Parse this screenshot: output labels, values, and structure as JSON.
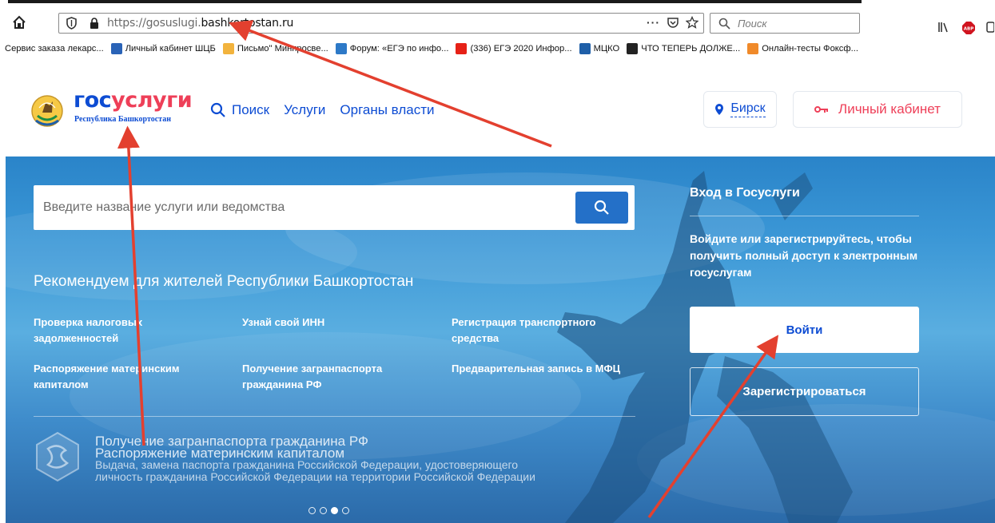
{
  "browser": {
    "url_prefix": "https://gosuslugi.",
    "url_domain": "bashkortostan.ru",
    "url_more": "···",
    "search_placeholder": "Поиск",
    "bookmarks": [
      {
        "label": "Сервис заказа лекарс...",
        "color": "transparent"
      },
      {
        "label": "Личный кабинет ШЦБ",
        "color": "#2a63b7"
      },
      {
        "label": "Письмо\" Минпросве...",
        "color": "#f2b33d"
      },
      {
        "label": "Форум: «ЕГЭ по инфо...",
        "color": "#2d79c7"
      },
      {
        "label": "(336) ЕГЭ 2020 Инфор...",
        "color": "#e62117"
      },
      {
        "label": "МЦКО",
        "color": "#1f5fa8"
      },
      {
        "label": "ЧТО ТЕПЕРЬ ДОЛЖЕ...",
        "color": "#222222"
      },
      {
        "label": "Онлайн-тесты Фоксф...",
        "color": "#f08a2a"
      }
    ]
  },
  "header": {
    "logo_part1": "гос",
    "logo_part2": "услуги",
    "logo_sub": "Республика Башкортостан",
    "nav": {
      "search": "Поиск",
      "services": "Услуги",
      "authorities": "Органы власти"
    },
    "city": "Бирск",
    "cabinet": "Личный кабинет"
  },
  "hero": {
    "search_placeholder": "Введите название услуги или ведомства",
    "rec_title": "Рекомендуем для жителей Республики Башкортостан",
    "rec_items": [
      "Проверка налоговых задолженностей",
      "Узнай свой ИНН",
      "Регистрация транспортного средства",
      "Распоряжение материнским капиталом",
      "Получение загранпаспорта гражданина РФ",
      "Предварительная запись в МФЦ"
    ],
    "slide_lines": [
      "Получение загранпаспорта гражданина РФ",
      "Распоряжение материнским капиталом",
      "Выдача, замена паспорта гражданина Российской Федерации, удостоверяющего",
      "личность гражданина Российской Федерации на территории Российской Федерации"
    ],
    "slides_total": 4,
    "slide_active": 3
  },
  "login": {
    "title": "Вход в Госуслуги",
    "text": "Войдите или зарегистрируйтесь, чтобы получить полный доступ к электронным госуслугам",
    "login_button": "Войти",
    "register_button": "Зарегистрироваться"
  },
  "colors": {
    "brand_blue": "#0d4cd3",
    "brand_red": "#ee3f58",
    "arrow_red": "#e3402f"
  }
}
